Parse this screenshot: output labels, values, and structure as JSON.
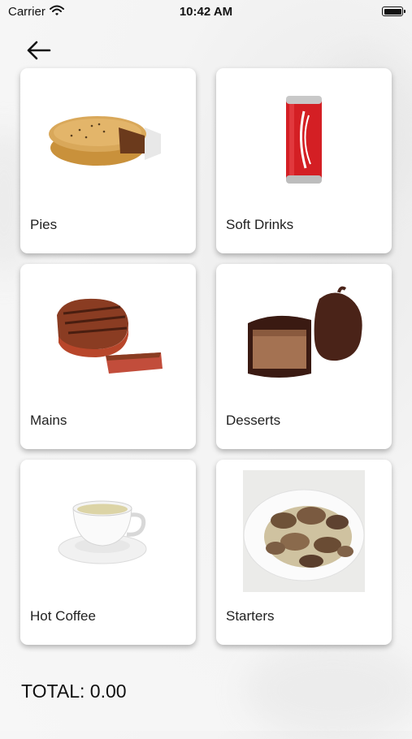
{
  "status_bar": {
    "carrier": "Carrier",
    "time": "10:42 AM"
  },
  "categories": [
    {
      "label": "Pies",
      "icon": "pie-image"
    },
    {
      "label": "Soft Drinks",
      "icon": "cola-can-image"
    },
    {
      "label": "Mains",
      "icon": "steak-image"
    },
    {
      "label": "Desserts",
      "icon": "chocolate-dessert-image"
    },
    {
      "label": "Hot Coffee",
      "icon": "coffee-cup-image"
    },
    {
      "label": "Starters",
      "icon": "mushrooms-image"
    }
  ],
  "total": {
    "text": "TOTAL: 0.00"
  },
  "colors": {
    "card": "#ffffff",
    "text": "#222222",
    "background": "#f4f4f4"
  }
}
